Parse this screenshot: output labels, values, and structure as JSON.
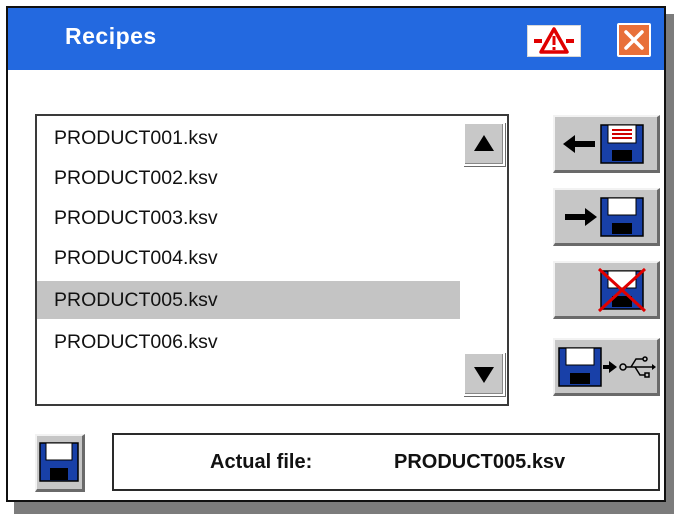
{
  "window": {
    "title": "Recipes",
    "warning_icon": "warning-triangle-icon",
    "close_icon": "close-x-icon"
  },
  "file_list": {
    "items": [
      "PRODUCT001.ksv",
      "PRODUCT002.ksv",
      "PRODUCT003.ksv",
      "PRODUCT004.ksv",
      "PRODUCT005.ksv",
      "PRODUCT006.ksv"
    ],
    "selected": "PRODUCT005.ksv",
    "scroll_up_icon": "triangle-up-icon",
    "scroll_down_icon": "triangle-down-icon"
  },
  "side_buttons": [
    {
      "name": "load-recipe-button",
      "icon": "arrow-left-floppy-icon"
    },
    {
      "name": "save-recipe-button",
      "icon": "arrow-right-floppy-icon"
    },
    {
      "name": "delete-recipe-button",
      "icon": "floppy-crossed-icon"
    },
    {
      "name": "export-usb-button",
      "icon": "floppy-to-usb-icon"
    }
  ],
  "status": {
    "label": "Actual file:",
    "value": "PRODUCT005.ksv",
    "save_icon": "floppy-disk-icon"
  },
  "colors": {
    "titlebar": "#2369e0",
    "selection": "#c4c4c4",
    "button_face": "#c6c6c6",
    "close_button": "#e8703a",
    "warning_red": "#e00000"
  }
}
